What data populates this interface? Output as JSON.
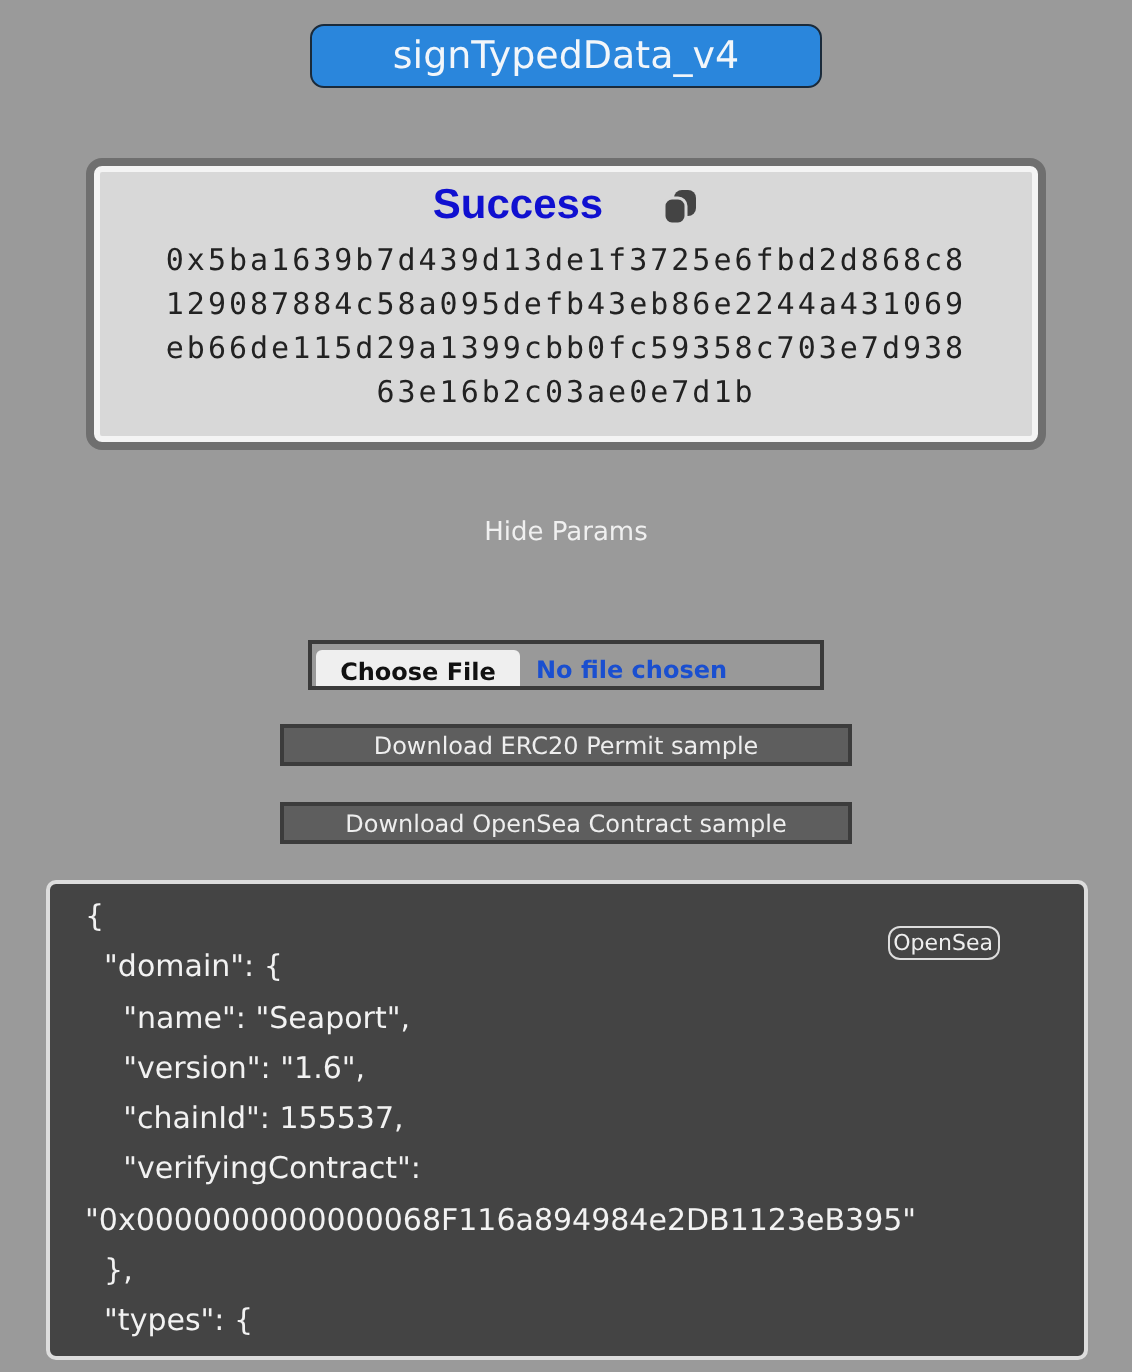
{
  "method_button": "signTypedData_v4",
  "result": {
    "status": "Success",
    "signature": "0x5ba1639b7d439d13de1f3725e6fbd2d868c8129087884c58a095defb43eb86e2244a431069eb66de115d29a1399cbb0fc59358c703e7d93863e16b2c03ae0e7d1b"
  },
  "toggle_link": "Hide Params",
  "file_input": {
    "button": "Choose File",
    "status": "No file chosen"
  },
  "buttons": [
    "Download ERC20 Permit sample",
    "Download OpenSea Contract sample"
  ],
  "editor": {
    "badge": "OpenSea",
    "lines": [
      "{",
      "  \"domain\": {",
      "    \"name\": \"Seaport\",",
      "    \"version\": \"1.6\",",
      "    \"chainId\": 155537,",
      "    \"verifyingContract\":",
      "\"0x0000000000000068F116a894984e2DB1123eB395\"",
      "  },",
      "  \"types\": {"
    ]
  }
}
